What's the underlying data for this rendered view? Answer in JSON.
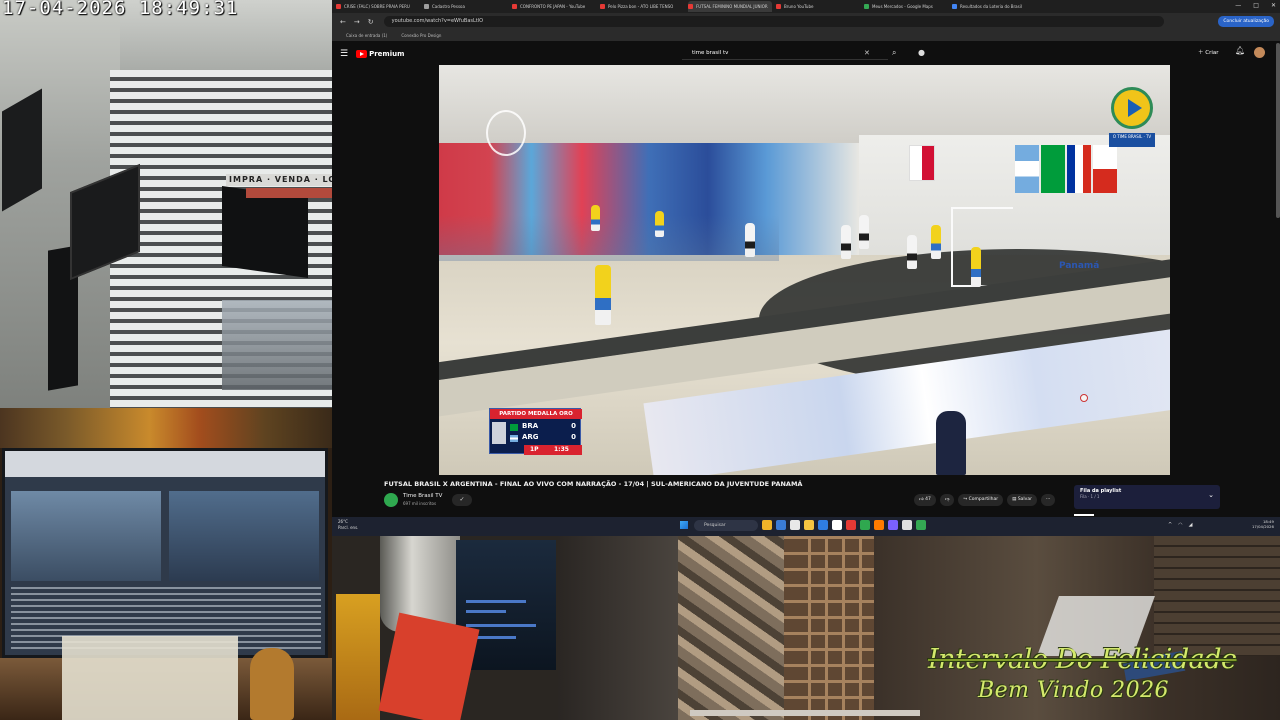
{
  "overlay": {
    "timestamp": "17-04-2026  18:49:31",
    "title": "Intervalo Do Felicidade",
    "subtitle": "Bem Vindo 2026"
  },
  "cameras": {
    "top_left_sign": "IMPRA · VENDA · LOT"
  },
  "browser": {
    "tabs": [
      {
        "label": "CRISE (FALC) SOBRE PRAIA PERU",
        "color": "#e53935"
      },
      {
        "label": "Cadastro Pessoa",
        "color": "#9e9e9e"
      },
      {
        "label": "CONFRONTO PE JAPAN - YouTube",
        "color": "#e53935"
      },
      {
        "label": "Pelo Pizza bon - ATO LIBE TENSO",
        "color": "#e53935"
      },
      {
        "label": "FUTSAL FEMININO MUNDIAL JUNIOR",
        "color": "#e53935",
        "active": true
      },
      {
        "label": "Bruno YouTube",
        "color": "#e53935"
      },
      {
        "label": "Meus Mercados - Google Maps",
        "color": "#34a853"
      },
      {
        "label": "Resultados da Loteria do Brasil",
        "color": "#4285f4"
      }
    ],
    "url": "youtube.com/watch?v=eWfuBasLtlO",
    "finish_button": "Concluir atualização",
    "bookmarks": [
      "Caixa de entrada (1)",
      "Conexão Pro Design"
    ]
  },
  "youtube": {
    "logo_text": "Premium",
    "search_query": "time brasil tv",
    "create_label": "Criar",
    "channel_badge": "O TIME BRASIL · TV",
    "video_title": "FUTSAL BRASIL X ARGENTINA - FINAL AO VIVO COM NARRAÇÃO - 17/04 | SUL-AMERICANO DA JUVENTUDE PANAMÁ",
    "channel_name": "Time Brasil TV",
    "channel_subs": "697 mil inscritos",
    "subscribe_label": "✓",
    "like_count": "47",
    "share_label": "Compartilhar",
    "save_label": "Salvar",
    "more_label": "···",
    "playlist_title": "Fila da playlist",
    "playlist_sub": "Fila · 1 / 1"
  },
  "scoreboard": {
    "title": "PARTIDO MEDALLA ORO",
    "team1": "BRA",
    "score1": "0",
    "team2": "ARG",
    "score2": "0",
    "period": "1P",
    "clock": "1:35"
  },
  "arena": {
    "ad_text": "Panamá"
  },
  "taskbar": {
    "weather_temp": "26°C",
    "weather_desc": "Parcl. ens.",
    "search_label": "Pesquisar",
    "time": "18:49",
    "date": "17/04/2026"
  }
}
